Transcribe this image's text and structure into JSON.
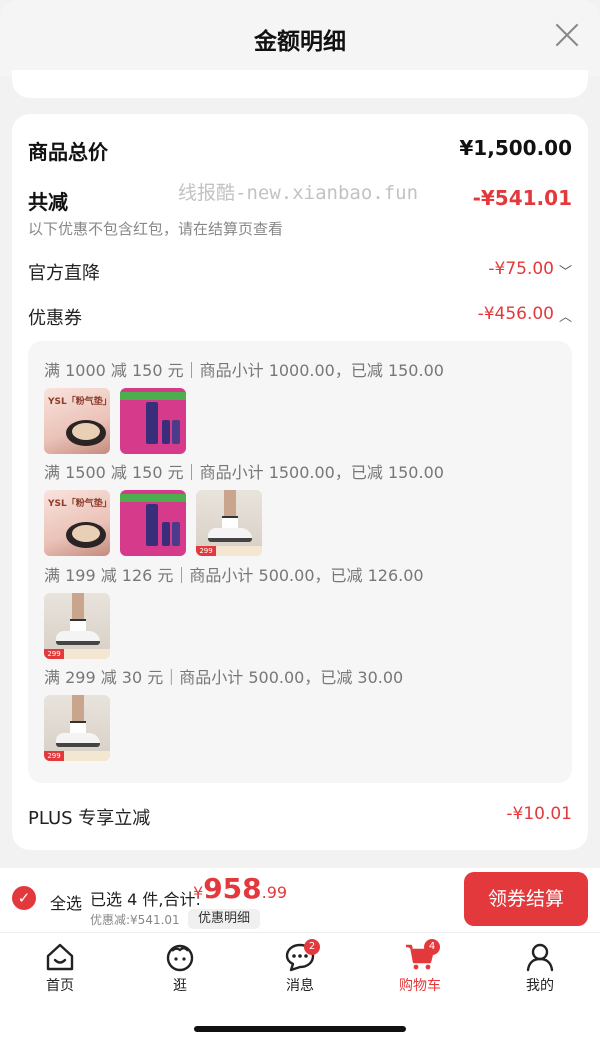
{
  "sheet": {
    "title": "金额明细"
  },
  "watermark": "线报酷-new.xianbao.fun",
  "summary": {
    "total_label": "商品总价",
    "total_value": "¥1,500.00",
    "reduce_label": "共减",
    "reduce_value": "-¥541.01",
    "note": "以下优惠不包含红包，请在结算页查看"
  },
  "official": {
    "label": "官方直降",
    "value": "-¥75.00",
    "caret": "﹀"
  },
  "coupon": {
    "label": "优惠券",
    "value": "-¥456.00",
    "caret": "︿"
  },
  "coupon_groups": [
    {
      "title": "满 1000 减 150 元｜商品小计 1000.00，已减 150.00",
      "items": [
        "ysl-cushion",
        "pink-kit"
      ]
    },
    {
      "title": "满 1500 减 150 元｜商品小计 1500.00，已减 150.00",
      "items": [
        "ysl-cushion",
        "pink-kit",
        "white-shoes"
      ]
    },
    {
      "title": "满 199 减 126 元｜商品小计 500.00，已减 126.00",
      "items": [
        "white-shoes"
      ]
    },
    {
      "title": "满 299 减 30 元｜商品小计 500.00，已减 30.00",
      "items": [
        "white-shoes"
      ]
    }
  ],
  "thumb_text": {
    "ysl": "YSL「粉气垫」",
    "shoe_price": "299"
  },
  "plus": {
    "label": "PLUS 专享立减",
    "value": "-¥10.01"
  },
  "bottom": {
    "check_mark": "✓",
    "select_all": "全选",
    "selected": "已选 4 件,合计:",
    "currency": "¥",
    "total_int": "958",
    "total_dec": ".99",
    "saving": "优惠减:¥541.01",
    "detail_btn": "优惠明细",
    "checkout_btn": "领券结算"
  },
  "tabs": [
    {
      "label": "首页",
      "icon": "home-icon"
    },
    {
      "label": "逛",
      "icon": "face-icon"
    },
    {
      "label": "消息",
      "icon": "message-icon",
      "badge": "2"
    },
    {
      "label": "购物车",
      "icon": "cart-icon",
      "badge": "4",
      "active": true
    },
    {
      "label": "我的",
      "icon": "user-icon"
    }
  ],
  "colors": {
    "accent": "#e4393c",
    "background": "#f2f2f2"
  }
}
